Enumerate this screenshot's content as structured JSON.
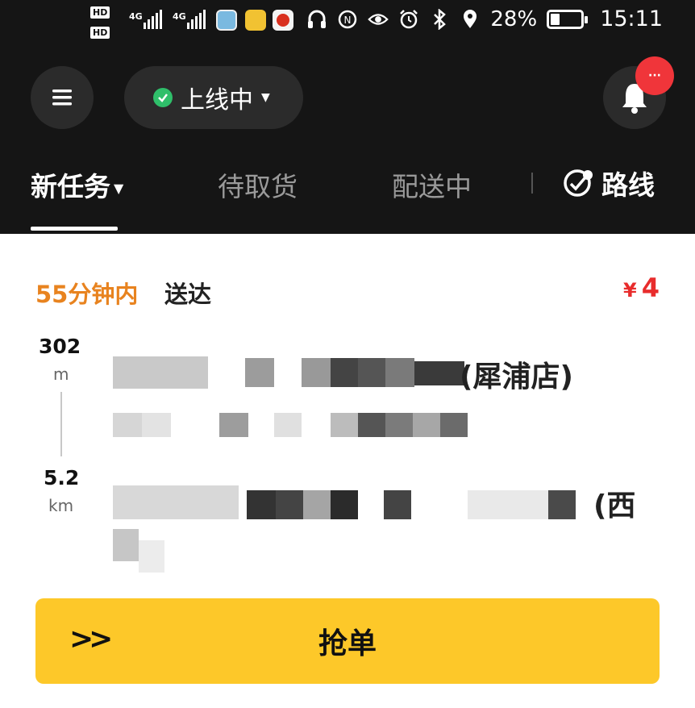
{
  "status_bar": {
    "hd1": "HD",
    "hd2": "HD",
    "sig1_label": "4G",
    "sig2_label": "4G",
    "battery_percent": "28%",
    "time": "15:11"
  },
  "header": {
    "online_status": "上线中",
    "online_status_color": "#2fbf6a",
    "notification_badge": "···"
  },
  "tabs": [
    {
      "label": "新任务",
      "active": true
    },
    {
      "label": "待取货",
      "active": false
    },
    {
      "label": "配送中",
      "active": false
    },
    {
      "label": "路线",
      "active": false
    }
  ],
  "order": {
    "deliver_time": "55分钟内",
    "deliver_suffix": "送达",
    "price_currency": "¥",
    "price_value": "4",
    "pickup_distance": "302",
    "pickup_distance_unit": "m",
    "pickup_name_visible_suffix": "(犀浦店)",
    "dropoff_distance": "5.2",
    "dropoff_distance_unit": "km",
    "dropoff_name_visible_suffix": "(西"
  },
  "action": {
    "grab_label": "抢单",
    "arrows": ">>"
  },
  "colors": {
    "accent_yellow": "#fdc829",
    "price_red": "#e82c2c",
    "time_orange": "#e8831f",
    "header_bg": "#151515"
  }
}
